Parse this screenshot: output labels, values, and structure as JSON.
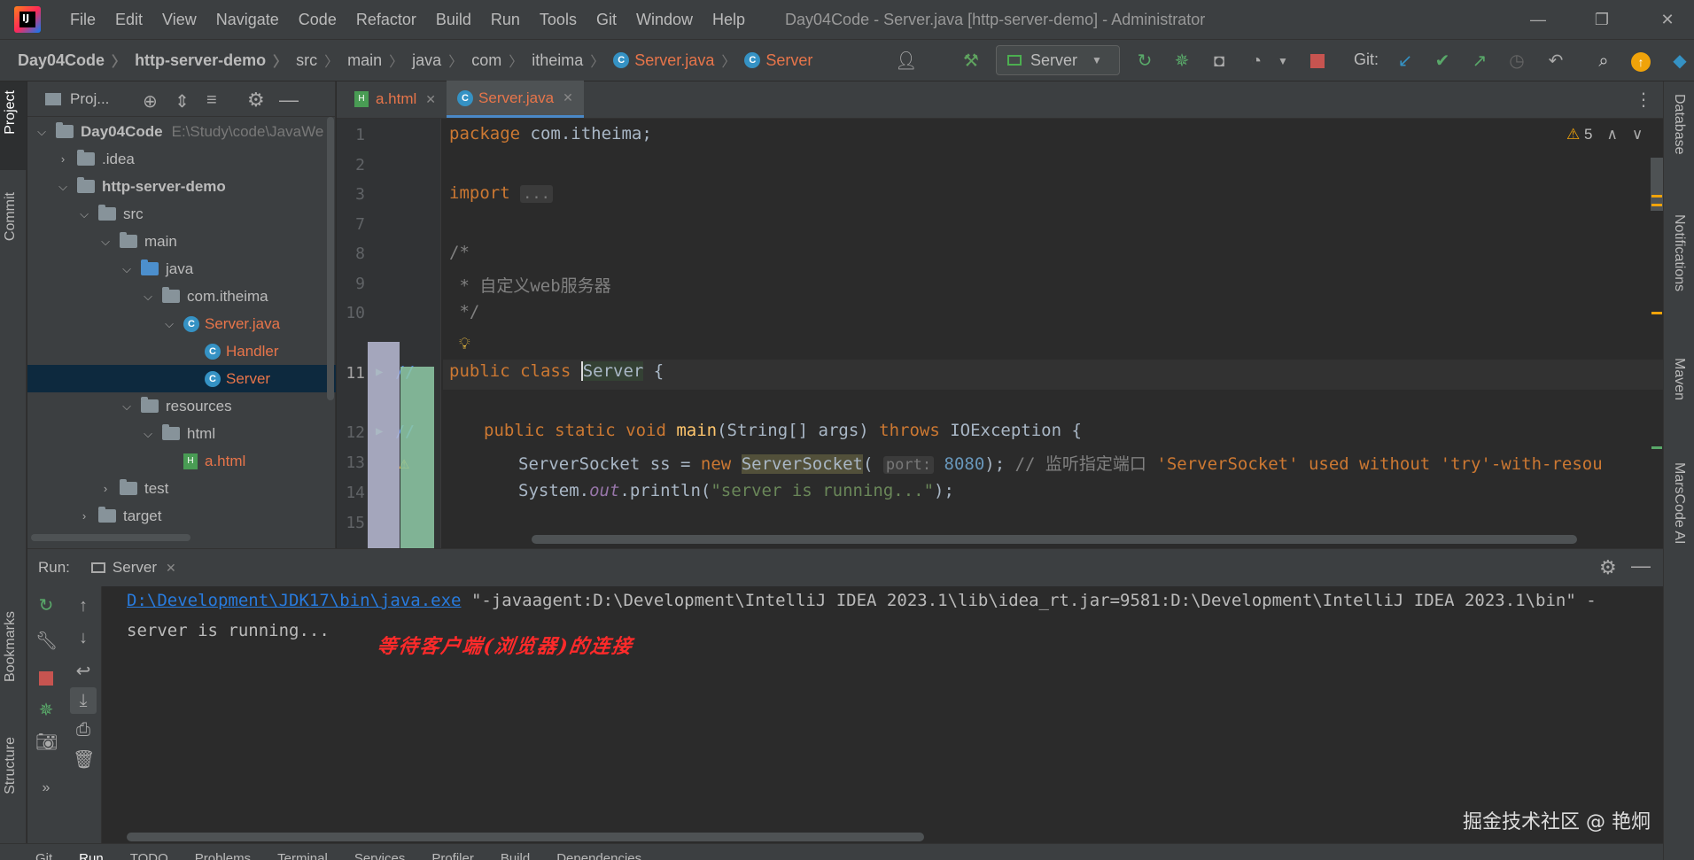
{
  "app": {
    "logo_text": "IJ",
    "menu": [
      "File",
      "Edit",
      "View",
      "Navigate",
      "Code",
      "Refactor",
      "Build",
      "Run",
      "Tools",
      "Git",
      "Window",
      "Help"
    ],
    "window_title": "Day04Code - Server.java [http-server-demo] - Administrator"
  },
  "breadcrumb": [
    "Day04Code",
    "http-server-demo",
    "src",
    "main",
    "java",
    "com",
    "itheima",
    "Server.java",
    "Server"
  ],
  "toolbar": {
    "run_config": "Server",
    "git_label": "Git:"
  },
  "left_strip": {
    "project": "Project",
    "commit": "Commit",
    "bookmarks": "Bookmarks",
    "structure": "Structure"
  },
  "right_strip": {
    "database": "Database",
    "notifications": "Notifications",
    "maven": "Maven",
    "marscode": "MarsCode AI"
  },
  "project_panel": {
    "title": "Proj...",
    "tree": [
      {
        "label": "Day04Code",
        "extra": "E:\\Study\\code\\JavaWe",
        "icon": "folder-icon"
      },
      {
        "label": ".idea",
        "icon": "folder-icon"
      },
      {
        "label": "http-server-demo",
        "icon": "folder-icon"
      },
      {
        "label": "src",
        "icon": "folder-icon"
      },
      {
        "label": "main",
        "icon": "folder-icon"
      },
      {
        "label": "java",
        "icon": "source-folder-icon"
      },
      {
        "label": "com.itheima",
        "icon": "package-icon"
      },
      {
        "label": "Server.java",
        "icon": "java-class-icon"
      },
      {
        "label": "Handler",
        "icon": "java-class-icon"
      },
      {
        "label": "Server",
        "icon": "java-class-icon"
      },
      {
        "label": "resources",
        "icon": "folder-icon"
      },
      {
        "label": "html",
        "icon": "folder-icon"
      },
      {
        "label": "a.html",
        "icon": "html-file-icon"
      },
      {
        "label": "test",
        "icon": "folder-icon"
      },
      {
        "label": "target",
        "icon": "folder-icon"
      }
    ]
  },
  "editor": {
    "tabs": [
      "a.html",
      "Server.java"
    ],
    "warnings_count": "5",
    "line_numbers": [
      "1",
      "2",
      "3",
      "7",
      "8",
      "9",
      "10",
      "11",
      "12",
      "13",
      "14",
      "15"
    ],
    "code": {
      "l1_kw": "package",
      "l1_rest": " com.itheima;",
      "l3_kw": "import",
      "l3_fold": "...",
      "l8": "/*",
      "l9": " * 自定义web服务器",
      "l10": " */",
      "l11_kw": "public class ",
      "l11_name": "Server",
      "l11_rest": " {",
      "l12_kw": "public static void ",
      "l12_fn": "main",
      "l12_args": "(String[] args) ",
      "l12_throws": "throws",
      "l12_rest": " IOException {",
      "l13_a": "ServerSocket ss = ",
      "l13_new": "new",
      "l13_cls": "ServerSocket",
      "l13_paren": "(",
      "l13_hint": "port:",
      "l13_num": "8080",
      "l13_close": "); ",
      "l13_comment": "// 监听指定端口 ",
      "l13_warn": "'ServerSocket' used without 'try'-with-resou",
      "l14_a": "System.",
      "l14_out": "out",
      "l14_b": ".println(",
      "l14_str": "\"server is running...\"",
      "l14_c": ");"
    }
  },
  "run_panel": {
    "label": "Run:",
    "tab": "Server",
    "console": {
      "java_path": "D:\\Development\\JDK17\\bin\\java.exe",
      "args": " \"-javaagent:D:\\Development\\IntelliJ IDEA 2023.1\\lib\\idea_rt.jar=9581:D:\\Development\\IntelliJ IDEA 2023.1\\bin\" -",
      "output": "server is running...",
      "annotation": "等待客户端(浏览器)的连接"
    }
  },
  "bottom_bar": [
    "Git",
    "Run",
    "TODO",
    "Problems",
    "Terminal",
    "Services",
    "Profiler",
    "Build",
    "Dependencies"
  ],
  "watermark": "掘金技术社区 @ 艳炯"
}
